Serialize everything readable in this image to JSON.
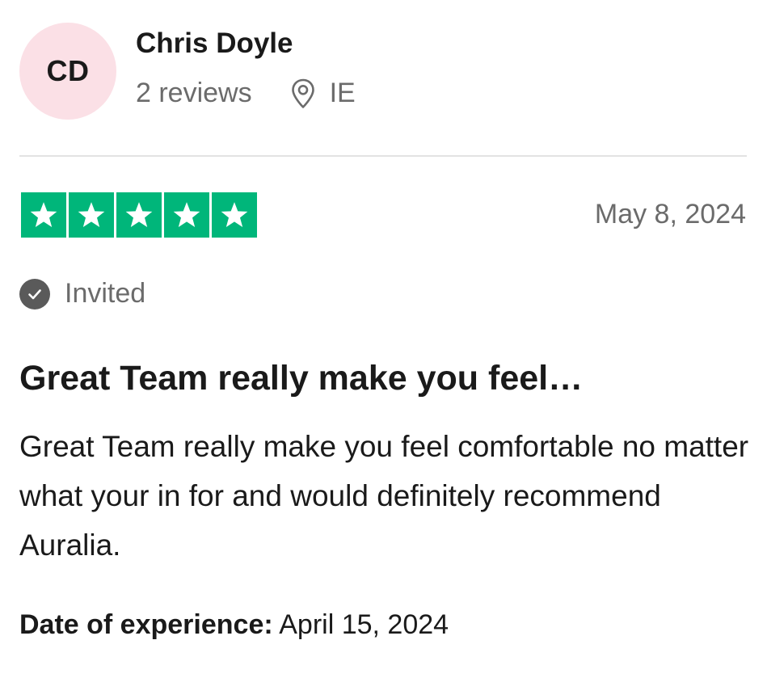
{
  "reviewer": {
    "initials": "CD",
    "name": "Chris Doyle",
    "reviews_count": "2 reviews",
    "location": "IE",
    "avatar_color": "#fbe0e6"
  },
  "review": {
    "rating": 5,
    "max_rating": 5,
    "star_color": "#00b67a",
    "date": "May 8, 2024",
    "status": "Invited",
    "title": "Great Team really make you feel…",
    "body": "Great Team really make you feel comfortable no matter what your in for and would definitely recommend Auralia.",
    "experience_label": "Date of experience:",
    "experience_date": "April 15, 2024"
  },
  "icons": {
    "location": "map-pin-icon",
    "status": "check-circle-icon",
    "star": "star-icon"
  }
}
